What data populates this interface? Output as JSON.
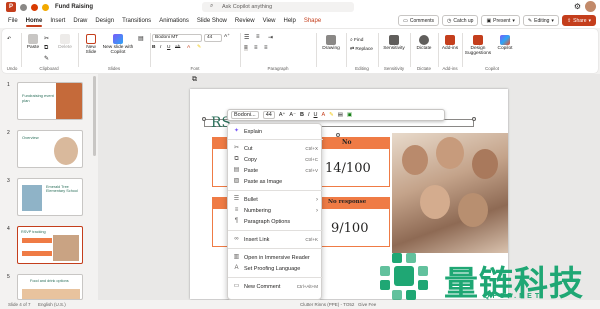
{
  "app": {
    "title": "Fund Raising",
    "search_placeholder": "Ask Copilot anything",
    "accent": "#c43e1c"
  },
  "title_actions": {
    "comments": "Comments",
    "catch_up": "Catch up",
    "present": "Present",
    "editing": "Editing",
    "share": "Share"
  },
  "tabs": [
    "File",
    "Home",
    "Insert",
    "Draw",
    "Design",
    "Transitions",
    "Animations",
    "Slide Show",
    "Review",
    "View",
    "Help",
    "Shape"
  ],
  "active_tab": "Home",
  "ribbon": {
    "undo_label": "Undo",
    "paste": "Paste",
    "clipboard": "Clipboard",
    "delete": "Delete",
    "new_slide": "New Slide",
    "new_slide_copilot": "New slide with Copilot",
    "slides": "Slides",
    "font_name": "Bodoni MT",
    "font_size": "44",
    "font": "Font",
    "paragraph": "Paragraph",
    "drawing": "Drawing",
    "find": "Find",
    "replace": "Replace",
    "editing": "Editing",
    "sensitivity": "Sensitivity",
    "dictate": "Dictate",
    "addins": "Add-ins",
    "designer": "Design Suggestions",
    "copilot": "Copilot"
  },
  "thumbnails": [
    {
      "num": "1",
      "title": "Fundraising event plan"
    },
    {
      "num": "2",
      "title": "Overview"
    },
    {
      "num": "3",
      "title": "Emerald Tree Elementary School"
    },
    {
      "num": "4",
      "title": "RSVP tracking"
    },
    {
      "num": "5",
      "title": "Food and drink options"
    }
  ],
  "mini_toolbar": {
    "font": "Bodoni...",
    "size": "44"
  },
  "slide": {
    "header_partial": "RS",
    "col1_label": "No",
    "col1_value": "14/100",
    "col2_label": "No response",
    "col2_value": "9/100"
  },
  "context_menu": [
    {
      "icon": "copilot-icon",
      "label": "Explain",
      "shortcut": ""
    },
    {
      "icon": "cut-icon",
      "label": "Cut",
      "shortcut": "Ctrl+X"
    },
    {
      "icon": "copy-icon",
      "label": "Copy",
      "shortcut": "Ctrl+C"
    },
    {
      "icon": "paste-icon",
      "label": "Paste",
      "shortcut": "Ctrl+V"
    },
    {
      "icon": "paste-image-icon",
      "label": "Paste as Image",
      "shortcut": ""
    },
    {
      "icon": "bullet-icon",
      "label": "Bullet",
      "shortcut": ""
    },
    {
      "icon": "numbering-icon",
      "label": "Numbering",
      "shortcut": ""
    },
    {
      "icon": "paragraph-icon",
      "label": "Paragraph Options",
      "shortcut": ""
    },
    {
      "icon": "link-icon",
      "label": "Insert Link",
      "shortcut": "Ctrl+K"
    },
    {
      "icon": "reader-icon",
      "label": "Open in Immersive Reader",
      "shortcut": ""
    },
    {
      "icon": "proofing-icon",
      "label": "Set Proofing Language",
      "shortcut": ""
    },
    {
      "icon": "comment-icon",
      "label": "New Comment",
      "shortcut": "Ctrl+Alt+M"
    }
  ],
  "status": {
    "slide": "Slide 4 of 7",
    "language": "English (U.S.)",
    "theme": "Clutter Rinns (PPE) - TO52",
    "feedback": "Give Fee"
  },
  "watermark": {
    "text": "量链科技",
    "sub": "QFSP.NET"
  }
}
